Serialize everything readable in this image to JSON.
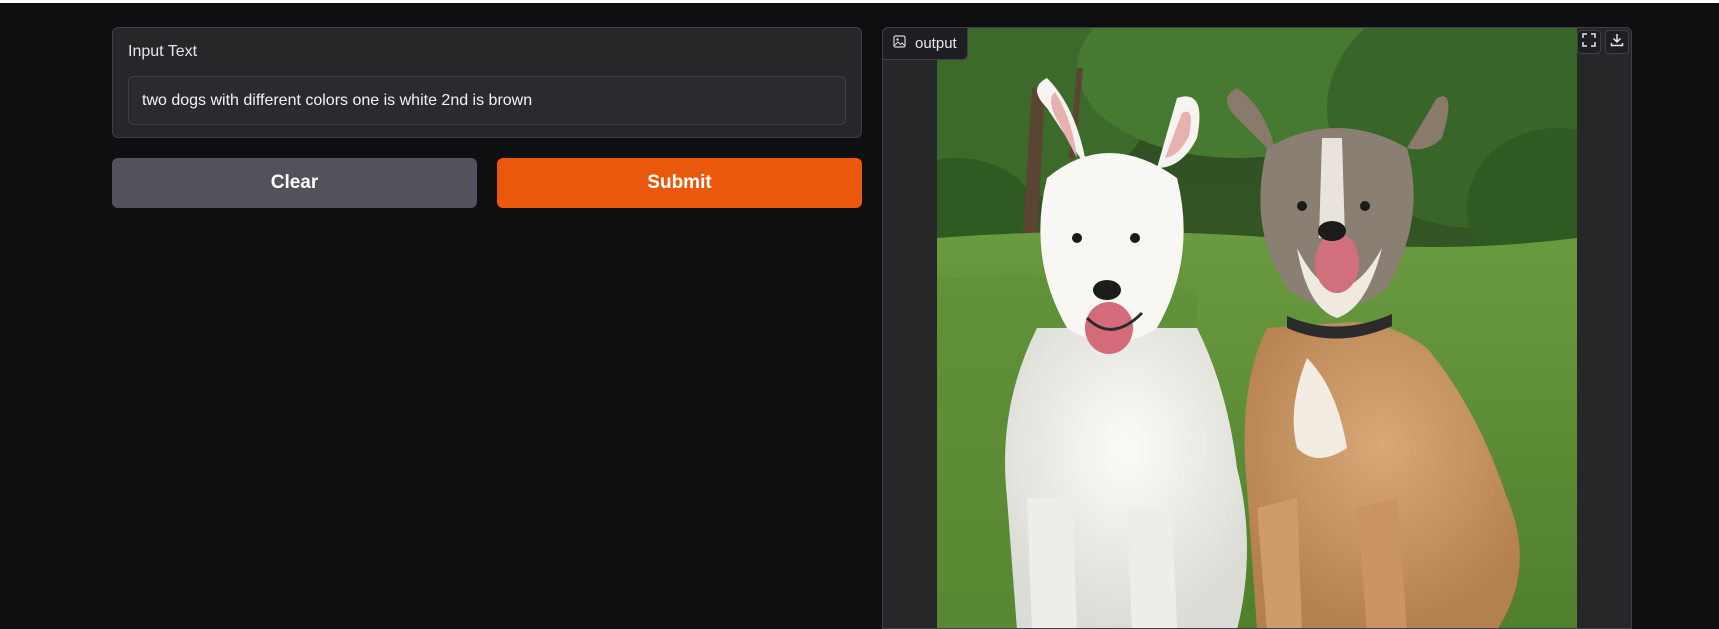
{
  "input": {
    "label": "Input Text",
    "value": "two dogs with different colors one is white 2nd is brown"
  },
  "buttons": {
    "clear_label": "Clear",
    "submit_label": "Submit"
  },
  "output": {
    "label": "output",
    "image_alt": "two dogs with different colors one is white 2nd is brown"
  },
  "icons": {
    "output_badge": "image-icon",
    "fullscreen": "fullscreen-icon",
    "download": "download-icon"
  },
  "colors": {
    "background": "#0f0f11",
    "panel": "#27272a",
    "clear_button": "#52525b",
    "submit_button": "#ea580c"
  }
}
